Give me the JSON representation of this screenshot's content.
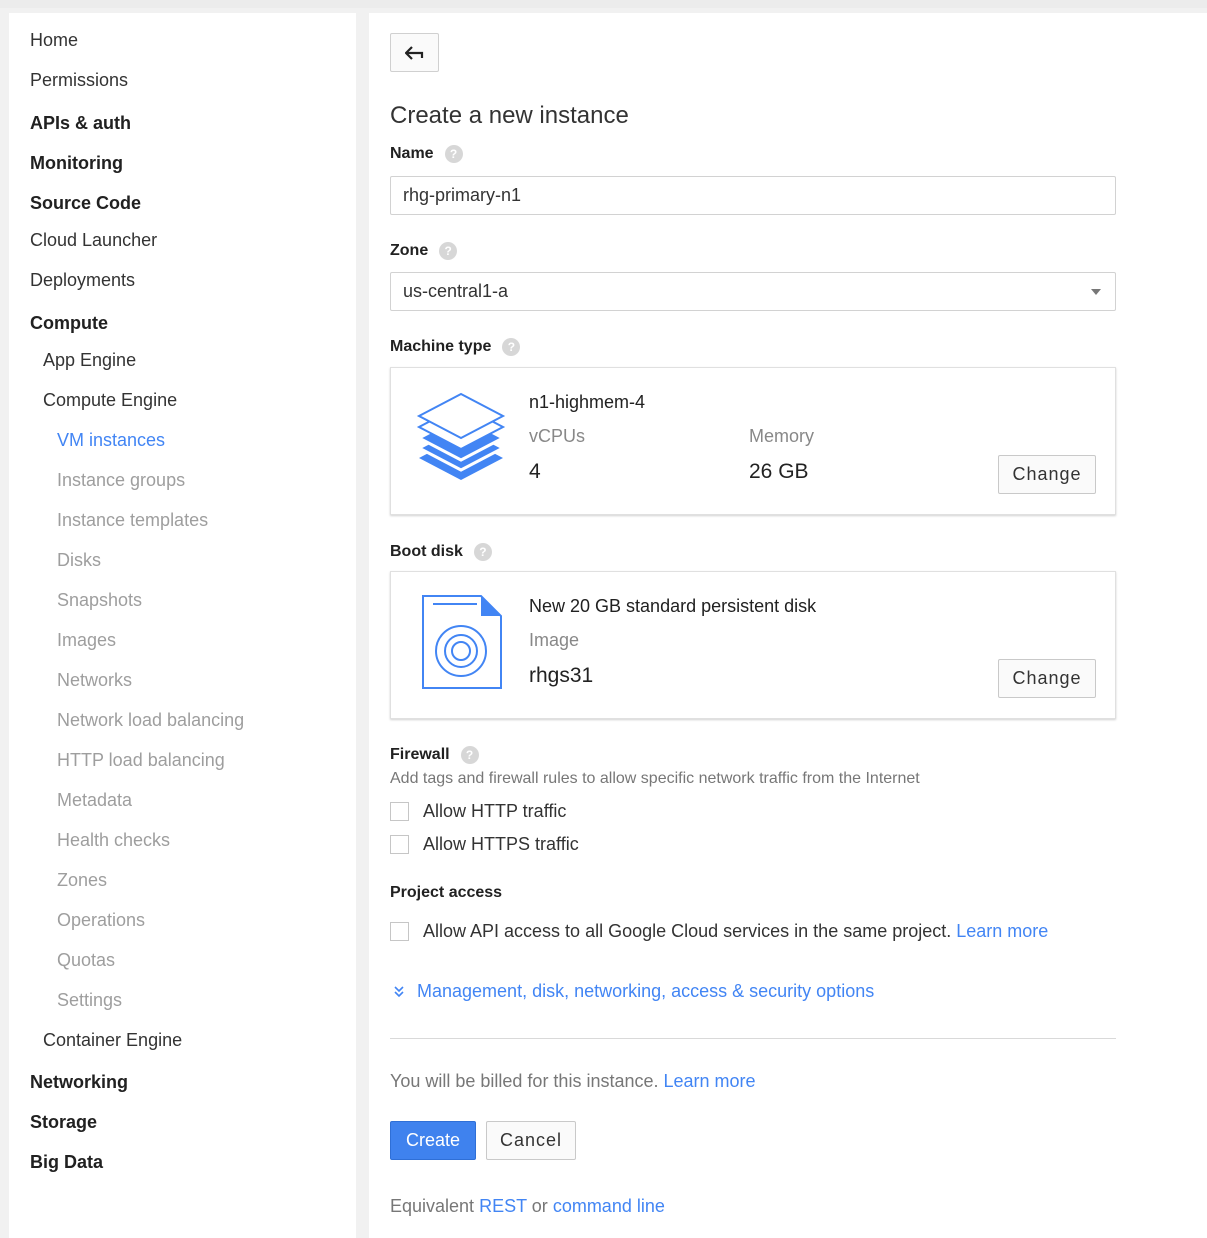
{
  "sidebar": {
    "items": [
      {
        "label": "Home"
      },
      {
        "label": "Permissions"
      },
      {
        "label": "APIs & auth"
      },
      {
        "label": "Monitoring"
      },
      {
        "label": "Source Code"
      },
      {
        "label": "Cloud Launcher"
      },
      {
        "label": "Deployments"
      },
      {
        "label": "Compute"
      },
      {
        "label": "App Engine"
      },
      {
        "label": "Compute Engine"
      },
      {
        "label": "VM instances"
      },
      {
        "label": "Instance groups"
      },
      {
        "label": "Instance templates"
      },
      {
        "label": "Disks"
      },
      {
        "label": "Snapshots"
      },
      {
        "label": "Images"
      },
      {
        "label": "Networks"
      },
      {
        "label": "Network load balancing"
      },
      {
        "label": "HTTP load balancing"
      },
      {
        "label": "Metadata"
      },
      {
        "label": "Health checks"
      },
      {
        "label": "Zones"
      },
      {
        "label": "Operations"
      },
      {
        "label": "Quotas"
      },
      {
        "label": "Settings"
      },
      {
        "label": "Container Engine"
      },
      {
        "label": "Networking"
      },
      {
        "label": "Storage"
      },
      {
        "label": "Big Data"
      }
    ]
  },
  "form": {
    "back_icon": "back-arrow-icon",
    "title": "Create a new instance",
    "help_glyph": "?",
    "name": {
      "label": "Name",
      "value": "rhg-primary-n1"
    },
    "zone": {
      "label": "Zone",
      "value": "us-central1-a"
    },
    "machine_type": {
      "label": "Machine type",
      "name": "n1-highmem-4",
      "vcpus_label": "vCPUs",
      "vcpus_value": "4",
      "memory_label": "Memory",
      "memory_value": "26 GB",
      "change_label": "Change"
    },
    "boot_disk": {
      "label": "Boot disk",
      "description": "New 20 GB standard persistent disk",
      "image_label": "Image",
      "image_value": "rhgs31",
      "change_label": "Change"
    },
    "firewall": {
      "label": "Firewall",
      "description": "Add tags and firewall rules to allow specific network traffic from the Internet",
      "http_label": "Allow HTTP traffic",
      "https_label": "Allow HTTPS traffic"
    },
    "project_access": {
      "label": "Project access",
      "api_label": "Allow API access to all Google Cloud services in the same project.",
      "learn_more": "Learn more"
    },
    "management_link": "Management, disk, networking, access & security options",
    "billing_text": "You will be billed for this instance.",
    "billing_learn_more": "Learn more",
    "create_label": "Create",
    "cancel_label": "Cancel",
    "equivalent_text": "Equivalent",
    "rest_link": "REST",
    "or_text": "or",
    "command_line_link": "command line"
  },
  "colors": {
    "accent": "#4285f4",
    "create_button": "#3f82ee",
    "disabled_nav": "#9e9e9e"
  }
}
